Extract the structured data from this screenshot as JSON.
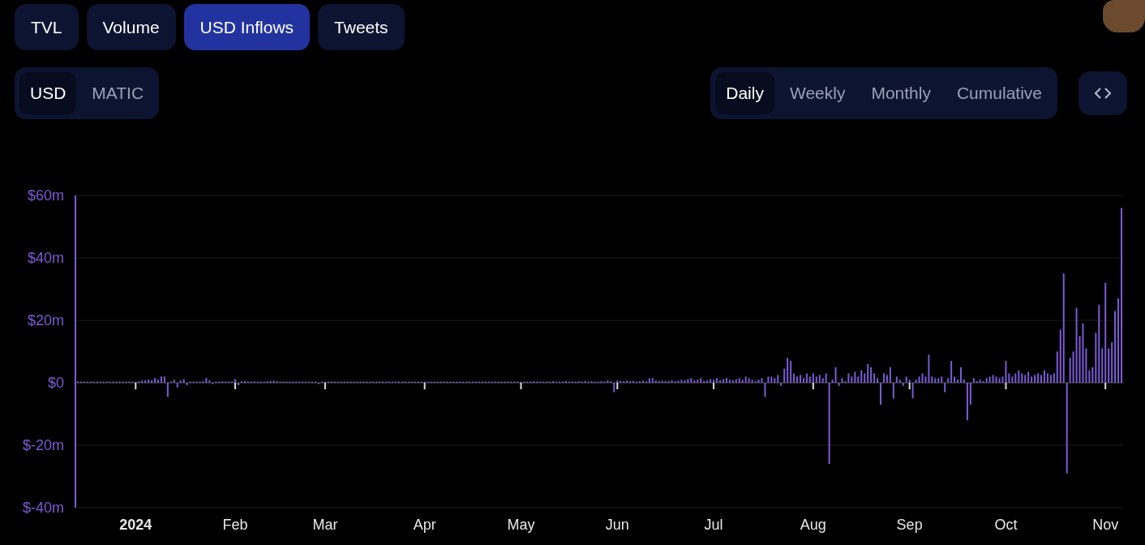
{
  "tabs": [
    {
      "label": "TVL",
      "selected": false
    },
    {
      "label": "Volume",
      "selected": false
    },
    {
      "label": "USD Inflows",
      "selected": true
    },
    {
      "label": "Tweets",
      "selected": false
    }
  ],
  "currency_toggle": [
    {
      "label": "USD",
      "selected": true
    },
    {
      "label": "MATIC",
      "selected": false
    }
  ],
  "period_toggle": [
    {
      "label": "Daily",
      "selected": true
    },
    {
      "label": "Weekly",
      "selected": false
    },
    {
      "label": "Monthly",
      "selected": false
    },
    {
      "label": "Cumulative",
      "selected": false
    }
  ],
  "chart_data": {
    "type": "bar",
    "grid": true,
    "ylim": [
      -40,
      60
    ],
    "categories": [
      null,
      null,
      null,
      null,
      null,
      null,
      null,
      null,
      null,
      null,
      null,
      null,
      null,
      null,
      null,
      null,
      null,
      null,
      "2024",
      null,
      null,
      null,
      null,
      null,
      null,
      null,
      null,
      null,
      null,
      null,
      null,
      null,
      null,
      null,
      null,
      null,
      null,
      null,
      null,
      null,
      null,
      null,
      null,
      null,
      null,
      null,
      null,
      null,
      null,
      "Feb",
      null,
      null,
      null,
      null,
      null,
      null,
      null,
      null,
      null,
      null,
      null,
      null,
      null,
      null,
      null,
      null,
      null,
      null,
      null,
      null,
      null,
      null,
      null,
      null,
      null,
      null,
      null,
      "Mar",
      null,
      null,
      null,
      null,
      null,
      null,
      null,
      null,
      null,
      null,
      null,
      null,
      null,
      null,
      null,
      null,
      null,
      null,
      null,
      null,
      null,
      null,
      null,
      null,
      null,
      null,
      null,
      null,
      null,
      null,
      "Apr",
      null,
      null,
      null,
      null,
      null,
      null,
      null,
      null,
      null,
      null,
      null,
      null,
      null,
      null,
      null,
      null,
      null,
      null,
      null,
      null,
      null,
      null,
      null,
      null,
      null,
      null,
      null,
      null,
      null,
      "May",
      null,
      null,
      null,
      null,
      null,
      null,
      null,
      null,
      null,
      null,
      null,
      null,
      null,
      null,
      null,
      null,
      null,
      null,
      null,
      null,
      null,
      null,
      null,
      null,
      null,
      null,
      null,
      null,
      null,
      "Jun",
      null,
      null,
      null,
      null,
      null,
      null,
      null,
      null,
      null,
      null,
      null,
      null,
      null,
      null,
      null,
      null,
      null,
      null,
      null,
      null,
      null,
      null,
      null,
      null,
      null,
      null,
      null,
      null,
      null,
      "Jul",
      null,
      null,
      null,
      null,
      null,
      null,
      null,
      null,
      null,
      null,
      null,
      null,
      null,
      null,
      null,
      null,
      null,
      null,
      null,
      null,
      null,
      null,
      null,
      null,
      null,
      null,
      null,
      null,
      null,
      null,
      "Aug",
      null,
      null,
      null,
      null,
      null,
      null,
      null,
      null,
      null,
      null,
      null,
      null,
      null,
      null,
      null,
      null,
      null,
      null,
      null,
      null,
      null,
      null,
      null,
      null,
      null,
      null,
      null,
      null,
      null,
      "Sep",
      null,
      null,
      null,
      null,
      null,
      null,
      null,
      null,
      null,
      null,
      null,
      null,
      null,
      null,
      null,
      null,
      null,
      null,
      null,
      null,
      null,
      null,
      null,
      null,
      null,
      null,
      null,
      null,
      null,
      "Oct",
      null,
      null,
      null,
      null,
      null,
      null,
      null,
      null,
      null,
      null,
      null,
      null,
      null,
      null,
      null,
      null,
      null,
      null,
      null,
      null,
      null,
      null,
      null,
      null,
      null,
      null,
      null,
      null,
      null,
      null,
      "Nov",
      null,
      null,
      null,
      null,
      null
    ],
    "yticks": [
      {
        "value": -40,
        "label": "$-40m"
      },
      {
        "value": -20,
        "label": "$-20m"
      },
      {
        "value": 0,
        "label": "$0"
      },
      {
        "value": 20,
        "label": "$20m"
      },
      {
        "value": 40,
        "label": "$40m"
      },
      {
        "value": 60,
        "label": "$60m"
      }
    ],
    "values": [
      0,
      0,
      0,
      0,
      0,
      0,
      0,
      0,
      0,
      0,
      0,
      0,
      0,
      0,
      0,
      0,
      0,
      0,
      0.3,
      0.5,
      0.7,
      0.8,
      1,
      0.8,
      1.5,
      1,
      2,
      2,
      -4.5,
      0.3,
      1,
      -1.5,
      0.8,
      1.2,
      -0.8,
      0.3,
      0.2,
      0.4,
      0.3,
      0.5,
      1.5,
      0.8,
      -0.3,
      0.2,
      0.3,
      0.5,
      0.2,
      0.4,
      0.3,
      1.2,
      -0.8,
      0.5,
      0.6,
      0.4,
      0.3,
      0.5,
      0.4,
      0.2,
      0.3,
      0.5,
      0.6,
      0.7,
      0.5,
      0.4,
      0.3,
      0.2,
      0.2,
      0.1,
      0.2,
      0.2,
      0.1,
      0.2,
      0.3,
      0.1,
      0.2,
      -0.3,
      0.2,
      0.2,
      0.1,
      0.2,
      0.1,
      0.3,
      0.2,
      0.1,
      0.2,
      0.1,
      0.2,
      0.2,
      0.1,
      0.2,
      0.1,
      0.3,
      0.2,
      0.1,
      0.2,
      0.1,
      0.2,
      0.2,
      0.1,
      0.2,
      0.1,
      0.3,
      0.2,
      0.1,
      0.2,
      0.1,
      0.2,
      0.1,
      0.1,
      0.2,
      0.1,
      0.2,
      0.1,
      0.2,
      0.1,
      0.2,
      0.1,
      0.2,
      0.1,
      0.2,
      0.1,
      0.2,
      0.1,
      0.2,
      0.1,
      0.2,
      0.1,
      0.2,
      0.1,
      0.2,
      0.1,
      0.2,
      0.1,
      0.2,
      0.1,
      0.2,
      0.1,
      0.2,
      0.2,
      0.3,
      0.2,
      0.3,
      0.5,
      0.3,
      0.2,
      0.3,
      0.2,
      0.3,
      0.5,
      0.3,
      0.4,
      0.3,
      0.6,
      0.3,
      0.4,
      0.3,
      0.5,
      0.3,
      0.6,
      0.4,
      0.5,
      0.4,
      0.3,
      0.5,
      0.4,
      0.8,
      0.5,
      -3,
      0.8,
      0.6,
      0.5,
      0.7,
      0.5,
      0.6,
      0.4,
      0.5,
      0.7,
      0.5,
      1.5,
      1.5,
      0.8,
      0.6,
      0.7,
      0.5,
      0.6,
      0.8,
      0.5,
      0.7,
      1,
      0.8,
      1.2,
      1.5,
      0.8,
      1,
      1.5,
      0.6,
      0.8,
      1.2,
      1,
      1.5,
      0.8,
      1.2,
      1.5,
      1,
      0.8,
      1.2,
      1.5,
      1,
      2,
      1.5,
      1,
      0.5,
      1,
      1.5,
      -4.5,
      2,
      2,
      1.5,
      2.5,
      -1,
      4.5,
      8,
      7,
      3,
      2,
      2.5,
      1.5,
      3,
      2,
      3,
      2,
      2.5,
      1.5,
      3,
      -26,
      1,
      5,
      -1,
      1.5,
      0.5,
      3,
      2,
      3.5,
      2,
      4,
      3,
      6,
      5,
      3,
      1.5,
      -7,
      3,
      2.5,
      5,
      -5,
      2,
      1,
      -1,
      2,
      1,
      -5,
      1,
      2,
      3,
      2,
      9,
      2,
      1.5,
      1.5,
      2,
      -3,
      1.5,
      7,
      2,
      1,
      5,
      1,
      -12,
      -7,
      1.5,
      0.5,
      1,
      0.5,
      1.5,
      2,
      2.5,
      2,
      1.5,
      2,
      7,
      3,
      2,
      3,
      4,
      3,
      2.5,
      3.5,
      2,
      2.5,
      3,
      2.5,
      4,
      3,
      2.5,
      3,
      10,
      17,
      35,
      -29,
      8,
      10,
      24,
      15,
      19,
      11,
      4,
      5,
      16,
      25,
      11,
      32,
      11,
      13,
      23,
      27,
      56
    ]
  }
}
